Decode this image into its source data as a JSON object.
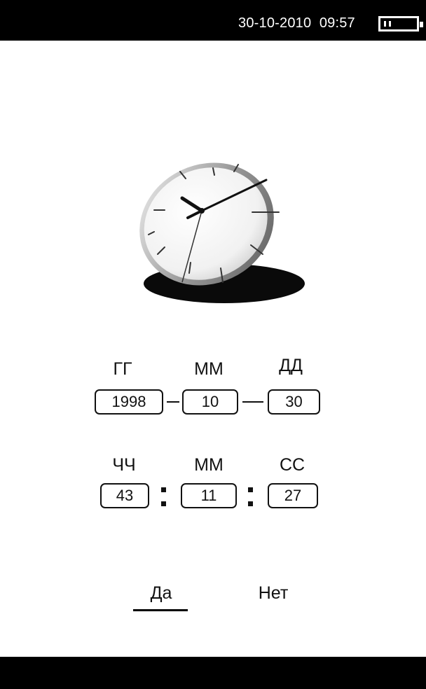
{
  "status_bar": {
    "datetime": "30-10-2010  09:57",
    "battery_icon": "battery-icon"
  },
  "illustration": {
    "icon": "wall-clock-icon"
  },
  "date": {
    "labels": [
      "ГГ",
      "ММ",
      "ДД"
    ],
    "year": "1998",
    "month": "10",
    "day": "30"
  },
  "time": {
    "labels": [
      "ЧЧ",
      "ММ",
      "СС"
    ],
    "hours": "43",
    "minutes": "11",
    "seconds": "27"
  },
  "actions": {
    "confirm_label": "Да",
    "cancel_label": "Нет",
    "selected": "confirm"
  },
  "colors": {
    "bar_bg": "#000000",
    "page_bg": "#ffffff",
    "text": "#111111"
  }
}
